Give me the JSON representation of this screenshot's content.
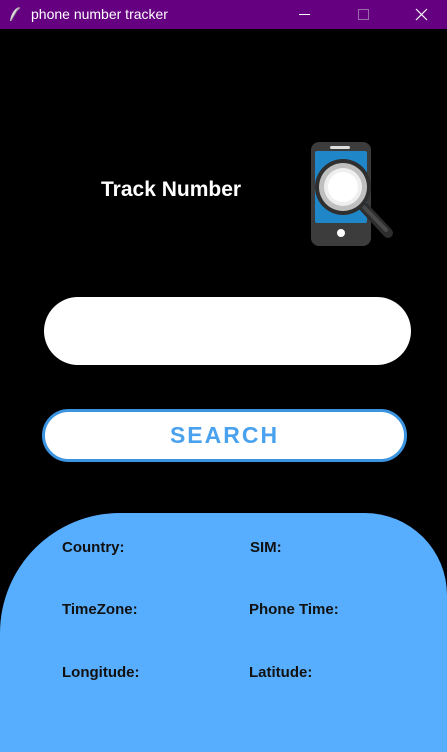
{
  "window": {
    "title": "phone number tracker",
    "titlebar_color": "#650081",
    "controls": [
      "minimize-icon",
      "maximize-icon",
      "close-icon"
    ]
  },
  "header": {
    "title": "Track Number",
    "logo_icon": "phone-magnifier-icon"
  },
  "search": {
    "input_value": "",
    "button_label": "SEARCH",
    "button_color": "#4aa2ef"
  },
  "info": {
    "panel_color": "#57adfe",
    "country_label": "Country:",
    "sim_label": "SIM:",
    "timezone_label": "TimeZone:",
    "phone_time_label": "Phone Time:",
    "longitude_label": "Longitude:",
    "latitude_label": "Latitude:"
  }
}
